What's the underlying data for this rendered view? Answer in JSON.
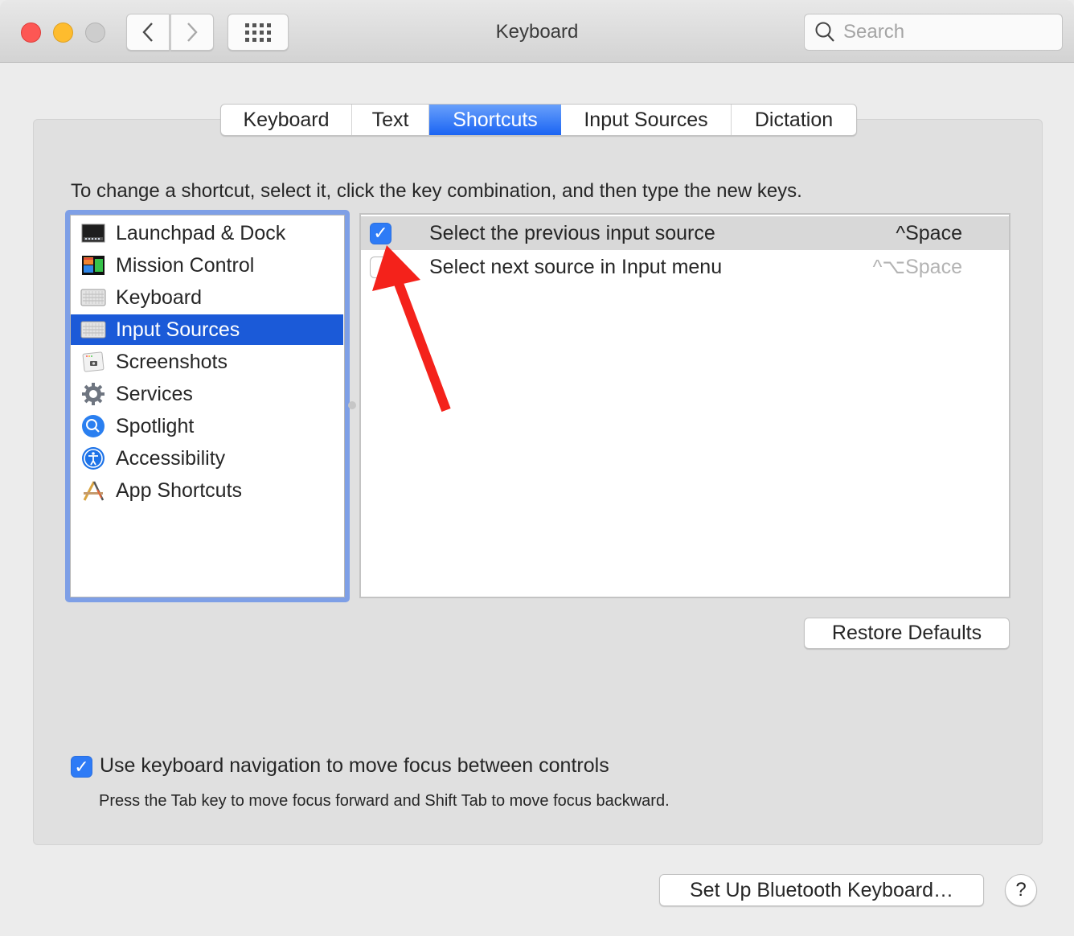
{
  "window": {
    "title": "Keyboard",
    "search_placeholder": "Search"
  },
  "tabs": [
    {
      "label": "Keyboard",
      "active": false
    },
    {
      "label": "Text",
      "active": false
    },
    {
      "label": "Shortcuts",
      "active": true
    },
    {
      "label": "Input Sources",
      "active": false
    },
    {
      "label": "Dictation",
      "active": false
    }
  ],
  "instruction": "To change a shortcut, select it, click the key combination, and then type the new keys.",
  "categories": [
    {
      "label": "Launchpad & Dock",
      "icon": "launchpad-dock-icon",
      "selected": false
    },
    {
      "label": "Mission Control",
      "icon": "mission-control-icon",
      "selected": false
    },
    {
      "label": "Keyboard",
      "icon": "keyboard-icon",
      "selected": false
    },
    {
      "label": "Input Sources",
      "icon": "keyboard-icon",
      "selected": true
    },
    {
      "label": "Screenshots",
      "icon": "screenshot-icon",
      "selected": false
    },
    {
      "label": "Services",
      "icon": "gear-icon",
      "selected": false
    },
    {
      "label": "Spotlight",
      "icon": "spotlight-search-icon",
      "selected": false
    },
    {
      "label": "Accessibility",
      "icon": "accessibility-icon",
      "selected": false
    },
    {
      "label": "App Shortcuts",
      "icon": "app-shortcuts-icon",
      "selected": false
    }
  ],
  "shortcuts": [
    {
      "label": "Select the previous input source",
      "keys": "^Space",
      "checked": true,
      "selected": true,
      "enabled": true
    },
    {
      "label": "Select next source in Input menu",
      "keys": "^⌥Space",
      "checked": false,
      "selected": false,
      "enabled": false
    }
  ],
  "buttons": {
    "restore_defaults": "Restore Defaults",
    "bluetooth": "Set Up Bluetooth Keyboard…",
    "help": "?"
  },
  "keyboard_navigation": {
    "checked": true,
    "label": "Use keyboard navigation to move focus between controls",
    "hint": "Press the Tab key to move focus forward and Shift Tab to move focus backward."
  },
  "check_glyph": "✓",
  "colors": {
    "accent": "#1b64f3",
    "selection": "#1b5ad8",
    "focus_ring": "#7e9fe6",
    "annotation_arrow": "#f4221b"
  }
}
